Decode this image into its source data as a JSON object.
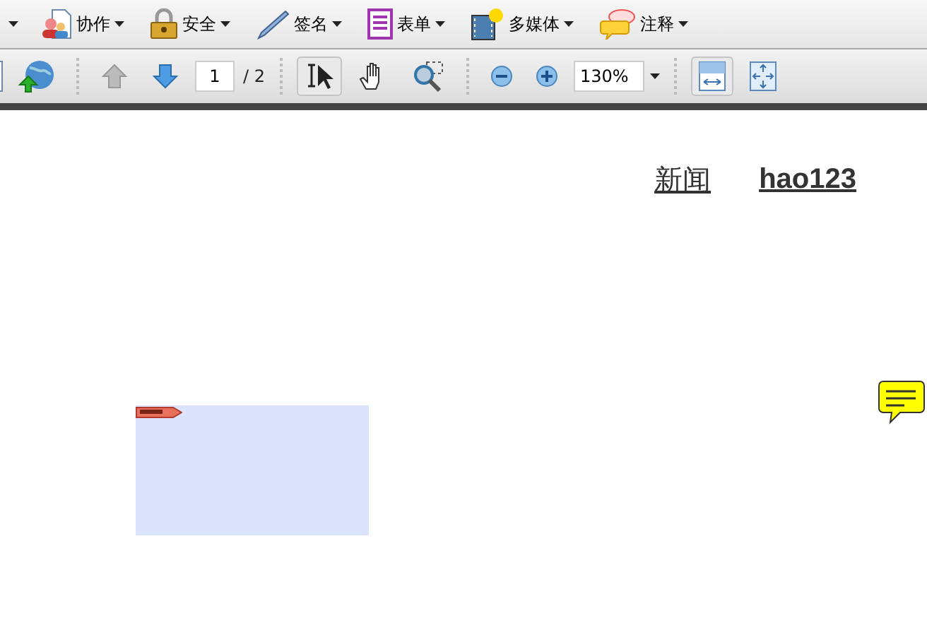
{
  "menu_toolbar": {
    "menus": [
      {
        "kind": "collaborate",
        "label": "协作"
      },
      {
        "kind": "security",
        "label": "安全"
      },
      {
        "kind": "sign",
        "label": "签名"
      },
      {
        "kind": "forms",
        "label": "表单"
      },
      {
        "kind": "multimedia",
        "label": "多媒体"
      },
      {
        "kind": "comment",
        "label": "注释"
      }
    ]
  },
  "nav_toolbar": {
    "page_number": "1",
    "page_total": "/ 2",
    "zoom": "130%",
    "tools": [
      {
        "kind": "select",
        "selected": true
      },
      {
        "kind": "hand",
        "selected": false
      },
      {
        "kind": "marquee",
        "selected": false
      }
    ],
    "views": [
      {
        "kind": "fit-width",
        "selected": true
      },
      {
        "kind": "full-screen",
        "selected": false
      }
    ]
  },
  "document": {
    "links": [
      {
        "text": "新闻",
        "bold": false
      },
      {
        "text": "hao123",
        "bold": true
      }
    ]
  }
}
